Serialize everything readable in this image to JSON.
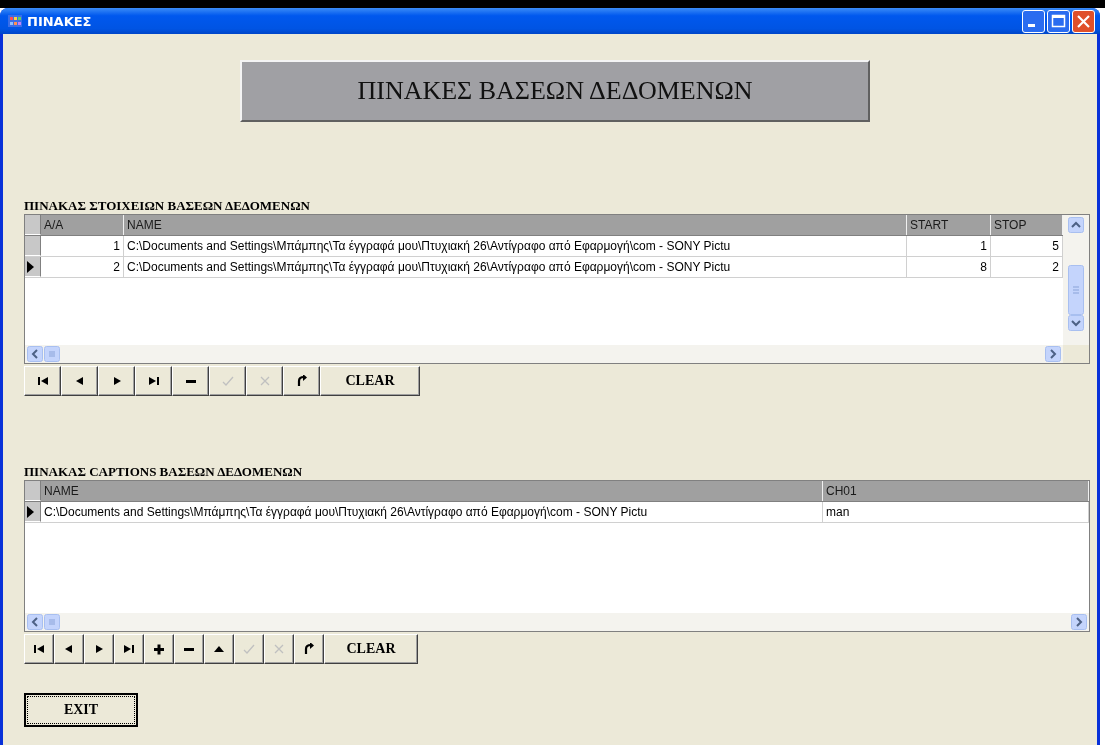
{
  "window": {
    "title": "ΠΙΝΑΚΕΣ"
  },
  "banner": "ΠΙΝΑΚΕΣ ΒΑΣΕΩΝ ΔΕΔΟΜΕΝΩΝ",
  "tables": [
    {
      "label": "ΠΙΝΑΚΑΣ ΣΤΟΙΧΕΙΩΝ ΒΑΣΕΩΝ ΔΕΔΟΜΕΝΩΝ",
      "vertical_scrollbar": true,
      "columns": [
        {
          "title": "A/A",
          "numeric": true
        },
        {
          "title": "NAME",
          "numeric": false
        },
        {
          "title": "START",
          "numeric": true
        },
        {
          "title": "STOP",
          "numeric": true
        }
      ],
      "rows": [
        {
          "selected": false,
          "cells": [
            "1",
            "C:\\Documents and Settings\\Μπάμπης\\Τα έγγραφά μου\\Πτυχιακή 26\\Αντίγραφο από Εφαρμογή\\com - SONY Pictu",
            "1",
            "5"
          ]
        },
        {
          "selected": true,
          "cells": [
            "2",
            "C:\\Documents and Settings\\Μπάμπης\\Τα έγγραφά μου\\Πτυχιακή 26\\Αντίγραφο από Εφαρμογή\\com - SONY Pictu",
            "8",
            "2"
          ]
        }
      ],
      "navigator": [
        {
          "kind": "first",
          "disabled": false
        },
        {
          "kind": "prior",
          "disabled": false
        },
        {
          "kind": "next",
          "disabled": false
        },
        {
          "kind": "last",
          "disabled": false
        },
        {
          "kind": "delete",
          "disabled": false
        },
        {
          "kind": "post",
          "disabled": true
        },
        {
          "kind": "cancel",
          "disabled": true
        },
        {
          "kind": "refresh",
          "disabled": false
        },
        {
          "kind": "clear",
          "label": "CLEAR"
        }
      ]
    },
    {
      "label": "ΠΙΝΑΚΑΣ CAPTIONS ΒΑΣΕΩΝ ΔΕΔΟΜΕΝΩΝ",
      "vertical_scrollbar": false,
      "columns": [
        {
          "title": "NAME",
          "numeric": false
        },
        {
          "title": "CH01",
          "numeric": false
        }
      ],
      "rows": [
        {
          "selected": true,
          "cells": [
            "C:\\Documents and Settings\\Μπάμπης\\Τα έγγραφά μου\\Πτυχιακή 26\\Αντίγραφο από Εφαρμογή\\com - SONY Pictu",
            "man"
          ]
        }
      ],
      "navigator": [
        {
          "kind": "first",
          "disabled": false
        },
        {
          "kind": "prior",
          "disabled": false
        },
        {
          "kind": "next",
          "disabled": false
        },
        {
          "kind": "last",
          "disabled": false
        },
        {
          "kind": "insert",
          "disabled": false
        },
        {
          "kind": "delete",
          "disabled": false
        },
        {
          "kind": "edit",
          "disabled": false
        },
        {
          "kind": "post",
          "disabled": true
        },
        {
          "kind": "cancel",
          "disabled": true
        },
        {
          "kind": "refresh",
          "disabled": false
        },
        {
          "kind": "clear",
          "label": "CLEAR"
        }
      ]
    }
  ],
  "exit_button": {
    "label": "EXIT",
    "focused": true
  }
}
